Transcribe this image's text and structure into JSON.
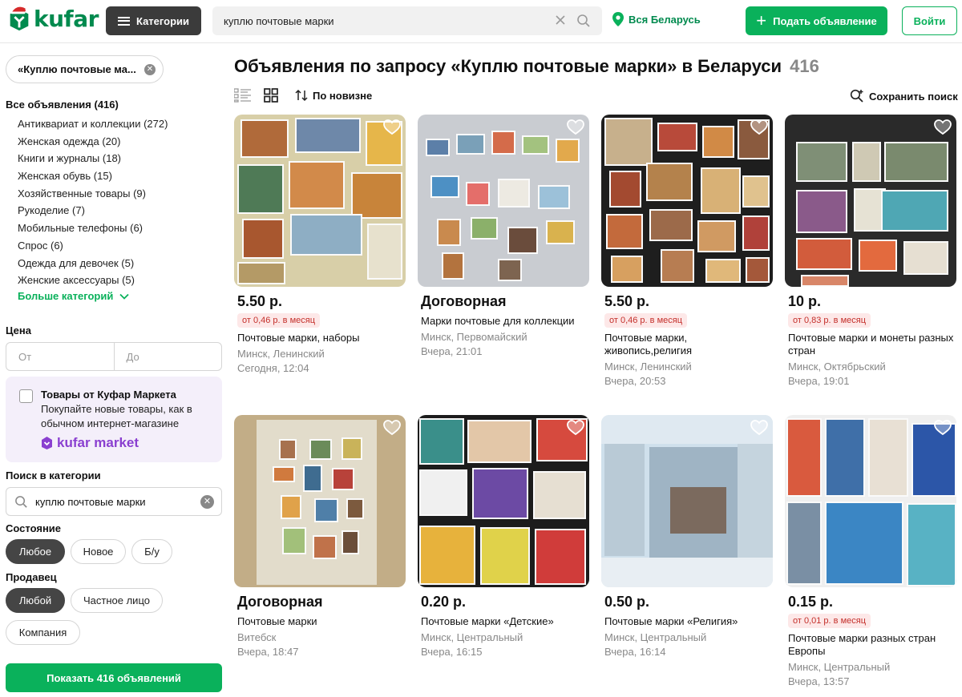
{
  "header": {
    "logo_text": "kufar",
    "categories_label": "Категории",
    "search_value": "куплю почтовые марки",
    "location_label": "Вся Беларусь",
    "post_button_label": "Подать объявление",
    "login_label": "Войти"
  },
  "sidebar": {
    "query_chip": "«Куплю почтовые ма...",
    "all_ads": "Все объявления (416)",
    "categories": [
      "Антиквариат и коллекции (272)",
      "Женская одежда (20)",
      "Книги и журналы (18)",
      "Женская обувь (15)",
      "Хозяйственные товары (9)",
      "Рукоделие (7)",
      "Мобильные телефоны (6)",
      "Спрос (6)",
      "Одежда для девочек (5)",
      "Женские аксессуары (5)"
    ],
    "more_categories": "Больше категорий",
    "price_label": "Цена",
    "price_from_placeholder": "От",
    "price_to_placeholder": "До",
    "market": {
      "title": "Товары от Куфар Маркета",
      "description": "Покупайте новые товары, как в обычном интернет-магазине",
      "logo_text": "kufar market"
    },
    "category_search_label": "Поиск в категории",
    "category_search_value": "куплю почтовые марки",
    "condition_label": "Состояние",
    "condition_options": [
      "Любое",
      "Новое",
      "Б/у"
    ],
    "seller_label": "Продавец",
    "seller_options": [
      "Любой",
      "Частное лицо",
      "Компания"
    ],
    "show_button": "Показать 416 объявлений"
  },
  "main": {
    "title": "Объявления по запросу «Куплю почтовые марки» в Беларуси",
    "count": "416",
    "sort_label": "По новизне",
    "save_search_label": "Сохранить поиск"
  },
  "listings": [
    {
      "price": "5.50 р.",
      "monthly": "от 0,46 р. в месяц",
      "name": "Почтовые марки, наборы",
      "location": "Минск, Ленинский",
      "time": "Сегодня, 12:04"
    },
    {
      "price": "Договорная",
      "monthly": "",
      "name": "Марки почтовые для коллекции",
      "location": "Минск, Первомайский",
      "time": "Вчера, 21:01"
    },
    {
      "price": "5.50 р.",
      "monthly": "от 0,46 р. в месяц",
      "name": "Почтовые марки, живопись,религия",
      "location": "Минск, Ленинский",
      "time": "Вчера, 20:53"
    },
    {
      "price": "10 р.",
      "monthly": "от 0,83 р. в месяц",
      "name": "Почтовые марки и монеты разных стран",
      "location": "Минск, Октябрьский",
      "time": "Вчера, 19:01"
    },
    {
      "price": "Договорная",
      "monthly": "",
      "name": "Почтовые марки",
      "location": "Витебск",
      "time": "Вчера, 18:47"
    },
    {
      "price": "0.20 р.",
      "monthly": "",
      "name": "Почтовые марки «Детские»",
      "location": "Минск, Центральный",
      "time": "Вчера, 16:15"
    },
    {
      "price": "0.50 р.",
      "monthly": "",
      "name": "Почтовые марки «Религия»",
      "location": "Минск, Центральный",
      "time": "Вчера, 16:14"
    },
    {
      "price": "0.15 р.",
      "monthly": "от 0,01 р. в месяц",
      "name": "Почтовые марки разных стран Европы",
      "location": "Минск, Центральный",
      "time": "Вчера, 13:57"
    }
  ],
  "colors": {
    "brand_green": "#0ab15b",
    "logo_green": "#008a4e",
    "dark_button": "#3b3b3b",
    "market_purple": "#8a3fd0",
    "monthly_red": "#c4302b"
  }
}
